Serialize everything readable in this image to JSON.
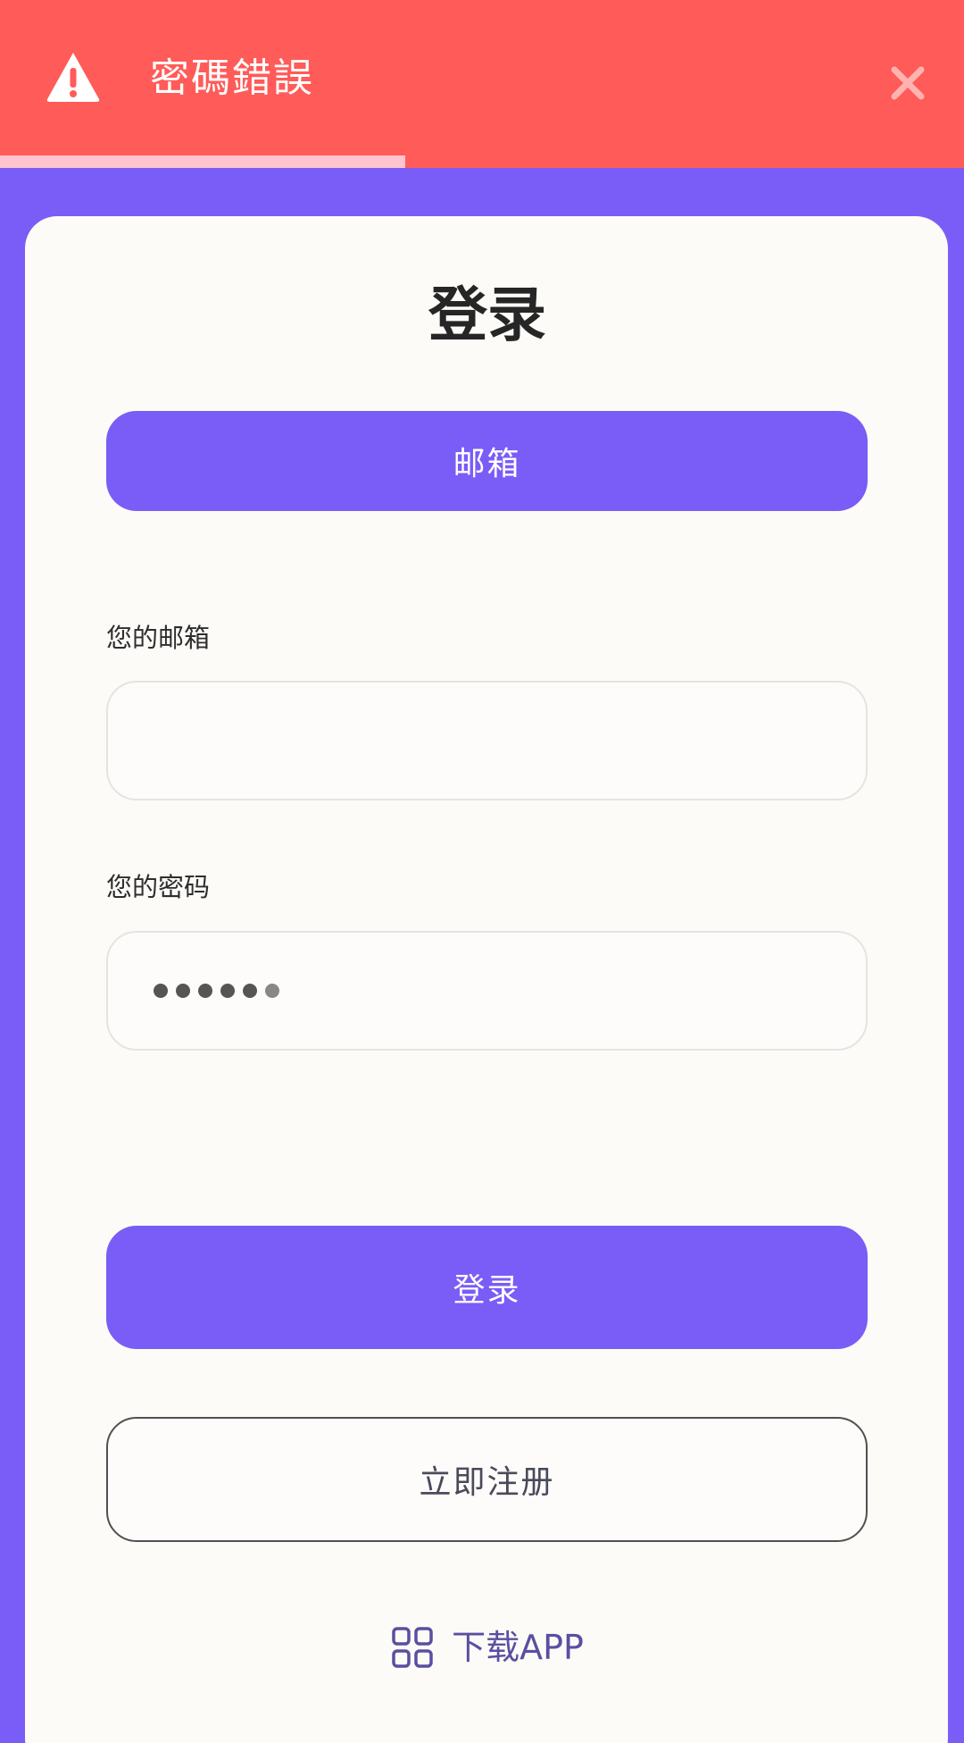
{
  "toast": {
    "icon": "warning-triangle-icon",
    "title": "密碼錯誤",
    "close_icon": "close-icon",
    "progress_fraction": 0.42,
    "background_color": "#ff5b58",
    "progress_color": "#ffc4cf"
  },
  "login": {
    "title": "登录",
    "method_tab_label": "邮箱",
    "email_label": "您的邮箱",
    "email_value": "",
    "password_label": "您的密码",
    "password_mask": "••••••",
    "submit_label": "登录",
    "register_label": "立即注册",
    "download_icon": "app-grid-icon",
    "download_label": "下载APP"
  },
  "colors": {
    "accent": "#7a5cf6",
    "card": "#fcfbf8",
    "error": "#ff5b58"
  }
}
